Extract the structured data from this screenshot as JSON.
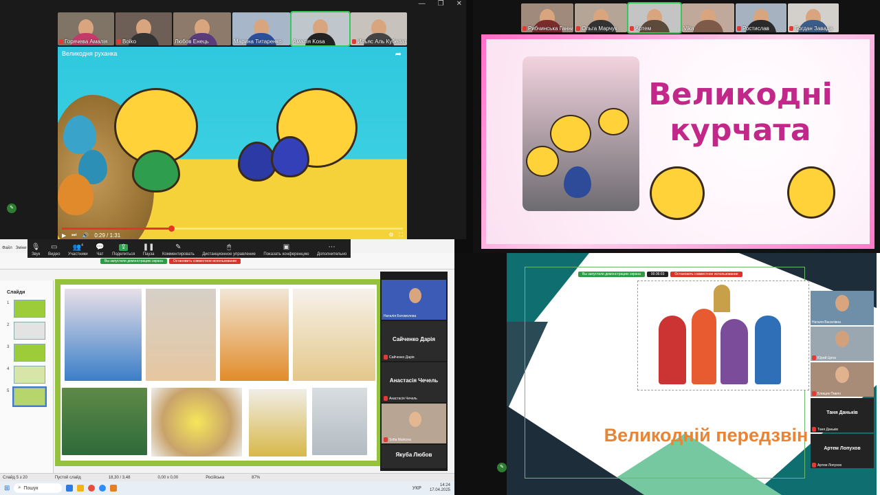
{
  "q1": {
    "participants": [
      "Горячева Амалія",
      "Boiko",
      "Любов Енець",
      "Марина Титаренко",
      "Амалія Kosa",
      "Ильяс Аль Кубелат"
    ],
    "video_title": "Великодня руханка",
    "time": "0:29 / 1:31",
    "progress": 0.32
  },
  "zoom_toolbar": {
    "items": [
      "Звук",
      "Видео",
      "Участники",
      "Чат",
      "Поделиться",
      "Пауза",
      "Комментировать",
      "Дистанционное управление",
      "Показать конференцию",
      "Дополнительно"
    ],
    "participants_count": "4"
  },
  "share_bar": {
    "sharing": "Вы запустили демонстрацию экрана",
    "stop": "Остановить совместное использование",
    "timer": "00:36:03"
  },
  "q2": {
    "participants": [
      "Рибчинська Ганна",
      "Ольга Марчук",
      "Артем",
      "Vika",
      "Ростислав",
      "Богдан Завада"
    ],
    "title_line1": "Великодні",
    "title_line2": "курчата"
  },
  "q3": {
    "menu": [
      "Файл",
      "Зміни"
    ],
    "slides_label": "Слайди",
    "slide_numbers": [
      "1",
      "2",
      "3",
      "4",
      "5"
    ],
    "status": {
      "slide": "Слайд 5 з 20",
      "layout": "Пустой слайд",
      "pos": "18,30 / 3,48",
      "size": "0,00 x 0,00",
      "lang": "Російська",
      "zoom": "87%"
    },
    "taskbar": {
      "search": "Пошук",
      "lang": "УКР",
      "time": "14:24",
      "date": "17.04.2025"
    },
    "video_panel": [
      {
        "big": "",
        "small": "Наталія Богомолова"
      },
      {
        "big": "Сайченко Дарія",
        "small": "Сайченко Дарія"
      },
      {
        "big": "Анастасія Чечель",
        "small": "Анастасія Чечель"
      },
      {
        "big": "",
        "small": "Sofia Markova"
      },
      {
        "big": "Якуба Любов",
        "small": ""
      }
    ]
  },
  "q4": {
    "bottom_title": "Великодній передзвін",
    "right_panel": [
      {
        "big": "",
        "small": "Наталя Василівна"
      },
      {
        "big": "",
        "small": "Юрий Цепа"
      },
      {
        "big": "",
        "small": "Блищик Павло"
      },
      {
        "big": "Таня Даньків",
        "small": "Таня Даньків"
      },
      {
        "big": "Артем Лопухов",
        "small": "Артем Лопухов"
      }
    ]
  }
}
